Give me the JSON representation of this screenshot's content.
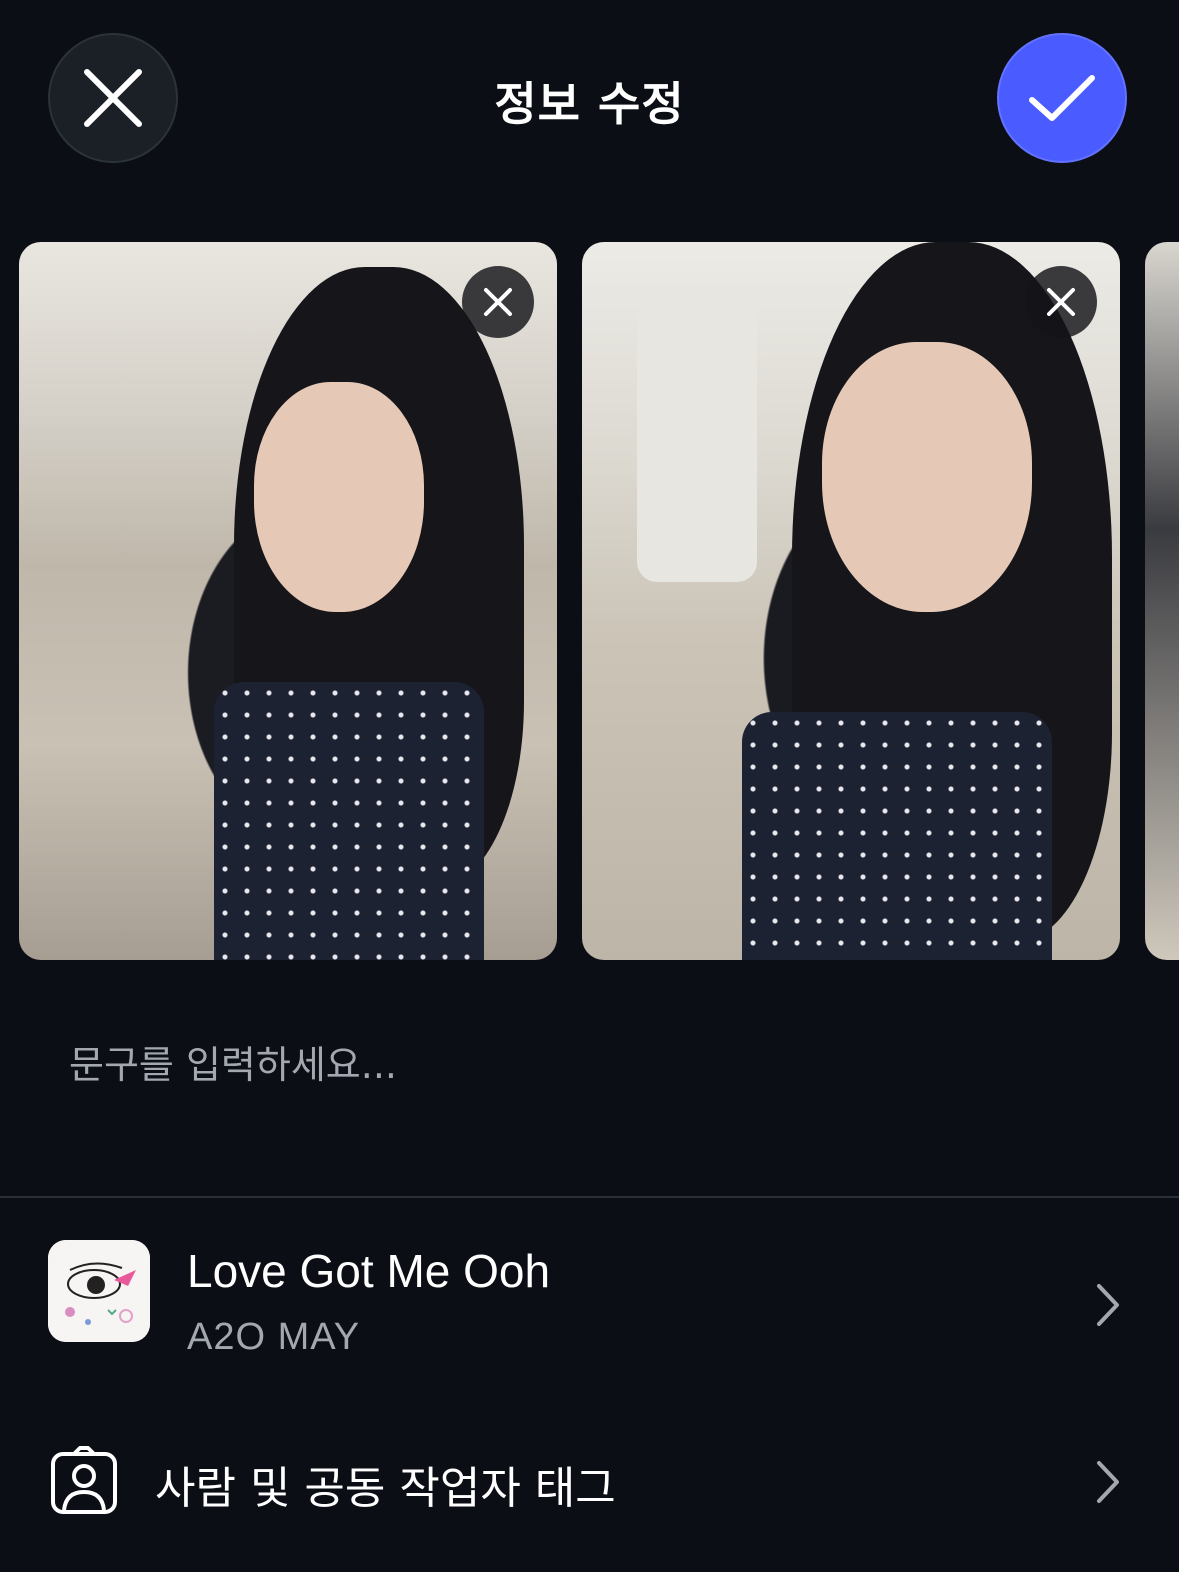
{
  "header": {
    "title": "정보 수정"
  },
  "photos": [
    {
      "alt": "selfie in subway station hallway"
    },
    {
      "alt": "selfie near white pillar"
    },
    {
      "alt": "partial next photo"
    }
  ],
  "caption": {
    "placeholder": "문구를 입력하세요...",
    "value": ""
  },
  "music": {
    "title": "Love Got Me Ooh",
    "artist": "A2O MAY"
  },
  "tag": {
    "label": "사람 및 공동 작업자 태그"
  },
  "colors": {
    "background": "#0b0e14",
    "accent": "#4a5cff",
    "secondary_text": "#a3a8b0",
    "divider": "#2b3039"
  },
  "icons": {
    "close": "close-icon",
    "confirm": "checkmark-icon",
    "remove_photo": "close-icon",
    "tag_people": "person-tag-icon",
    "chevron": "chevron-right-icon"
  }
}
